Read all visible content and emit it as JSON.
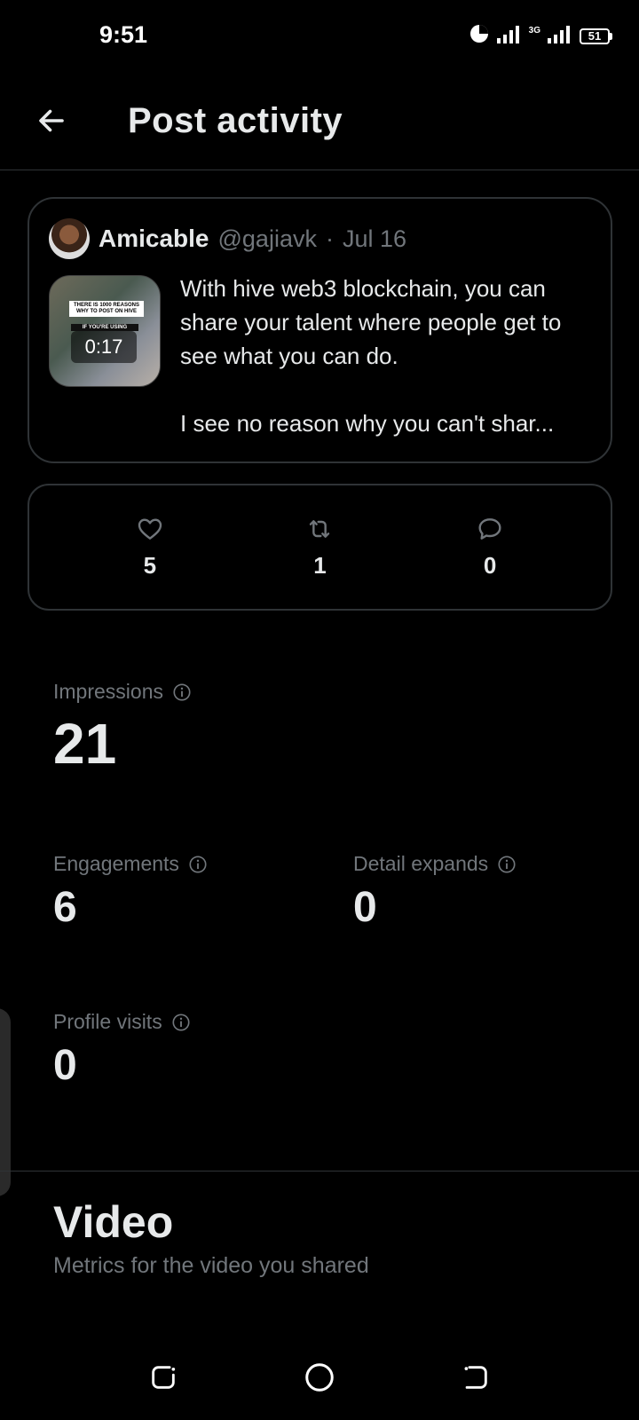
{
  "status_bar": {
    "time": "9:51",
    "network_label": "3G",
    "battery": "51"
  },
  "header": {
    "title": "Post activity"
  },
  "post": {
    "author_name": "Amicable",
    "author_handle": "@gajiavk",
    "separator": "·",
    "date": "Jul 16",
    "thumbnail": {
      "caption_line1": "THERE IS 1000 REASONS",
      "caption_line2": "WHY TO POST ON HIVE",
      "caption_line3": "IF YOU'RE USING",
      "duration": "0:17"
    },
    "text": "With hive web3 blockchain, you can share your talent where people get to see what you can do.\n\nI see no reason why you can't shar..."
  },
  "stats": {
    "likes": "5",
    "reposts": "1",
    "replies": "0"
  },
  "metrics": {
    "impressions": {
      "label": "Impressions",
      "value": "21"
    },
    "engagements": {
      "label": "Engagements",
      "value": "6"
    },
    "detail_expands": {
      "label": "Detail expands",
      "value": "0"
    },
    "profile_visits": {
      "label": "Profile visits",
      "value": "0"
    }
  },
  "video_section": {
    "title": "Video",
    "subtitle": "Metrics for the video you shared"
  },
  "colors": {
    "background": "#000000",
    "text_primary": "#e7e9ea",
    "text_secondary": "#71767b",
    "border": "#2f3336"
  }
}
